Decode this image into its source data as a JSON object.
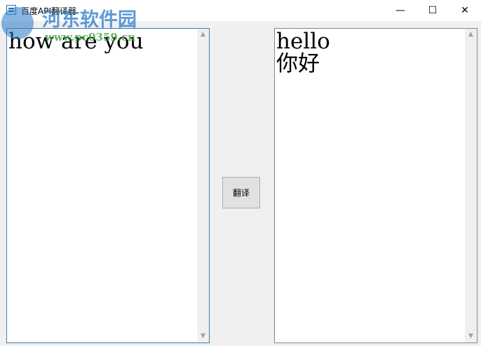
{
  "window": {
    "title": "百度API翻译器",
    "minimize": "—",
    "maximize": "☐",
    "close": "✕"
  },
  "input": {
    "text": "how are you"
  },
  "output": {
    "text": "hello\n你好"
  },
  "translate_button": "翻译",
  "scroll": {
    "up": "▲",
    "down": "▼"
  },
  "watermark": {
    "name": "河东软件园",
    "url": "www.pc0359.cn"
  }
}
